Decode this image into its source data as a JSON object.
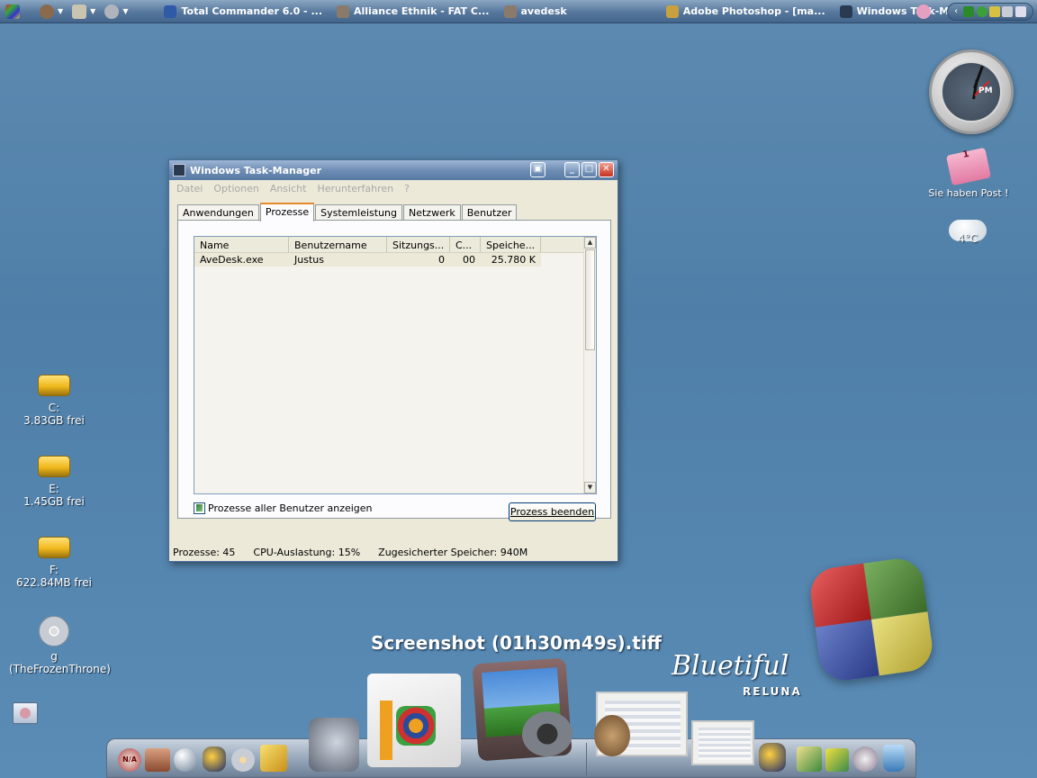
{
  "taskbar": {
    "tasks": [
      {
        "label": "Total Commander 6.0 - ...",
        "icon": "total-commander-icon",
        "color": "#2f5aa8"
      },
      {
        "label": "Alliance Ethnik - FAT C...",
        "icon": "cube-icon",
        "color": "#8a7a6a"
      },
      {
        "label": "avedesk",
        "icon": "cube-icon",
        "color": "#8a7a6a"
      },
      {
        "label": "Adobe Photoshop - [ma...",
        "icon": "photoshop-icon",
        "color": "#c8a040"
      },
      {
        "label": "Windows Task-Manager",
        "icon": "monitor-icon",
        "color": "#2a3a50"
      }
    ]
  },
  "widgets": {
    "clock_ampm": "PM",
    "mail_count": "1",
    "mail_label": "Sie haben Post !",
    "weather_temp": "4°C"
  },
  "drives": [
    {
      "name": "C:",
      "free": "3.83GB frei"
    },
    {
      "name": "E:",
      "free": "1.45GB frei"
    },
    {
      "name": "F:",
      "free": "622.84MB frei"
    },
    {
      "name": "g",
      "free": "(TheFrozenThrone)"
    }
  ],
  "task_manager": {
    "title": "Windows Task-Manager",
    "menu": [
      "Datei",
      "Optionen",
      "Ansicht",
      "Herunterfahren",
      "?"
    ],
    "tabs": [
      "Anwendungen",
      "Prozesse",
      "Systemleistung",
      "Netzwerk",
      "Benutzer"
    ],
    "active_tab": "Prozesse",
    "columns": [
      "Name",
      "Benutzername",
      "Sitzungs...",
      "C...",
      "Speiche..."
    ],
    "rows": [
      {
        "name": "AveDesk.exe",
        "user": "Justus",
        "session": "0",
        "cpu": "00",
        "mem": "25.780 K"
      }
    ],
    "show_all_label": "Prozesse aller Benutzer anzeigen",
    "end_button": "Prozess beenden",
    "status": {
      "processes": "Prozesse: 45",
      "cpu": "CPU-Auslastung: 15%",
      "memory": "Zugesicherter Speicher: 940M"
    }
  },
  "dock": {
    "caption": "Screenshot (01h30m49s).tiff",
    "brand": "Bluetiful",
    "brand_sub": "RELUNA",
    "na_badge": "N/A"
  }
}
